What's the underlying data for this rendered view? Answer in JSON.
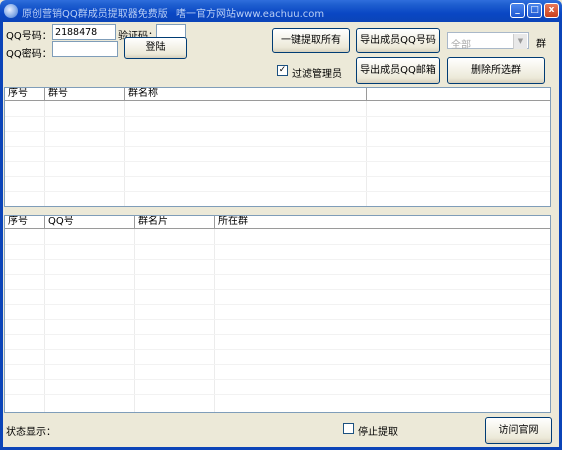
{
  "window": {
    "title": "原创营销QQ群成员提取器免费版",
    "site_text": "嗜一官方网站www.eachuu.com",
    "controls": {
      "minimize": "_",
      "maximize": "□",
      "close": "x"
    }
  },
  "login": {
    "qq_label": "QQ号码：",
    "qq_value": "2188478",
    "captcha_label": "验证码：",
    "captcha_value": "",
    "password_label": "QQ密码：",
    "password_value": "",
    "login_button": "登陆"
  },
  "actions": {
    "extract_all": "一键提取所有",
    "export_qq": "导出成员QQ号码",
    "filter_admin_label": "过滤管理员",
    "filter_admin_checked": "✓",
    "export_email": "导出成员QQ邮箱",
    "delete_selected": "删除所选群",
    "group_select_value": "全部",
    "group_label": "群"
  },
  "groups_table": {
    "columns": [
      "序号",
      "群号",
      "群名称"
    ]
  },
  "members_table": {
    "columns": [
      "序号",
      "QQ号",
      "群名片",
      "所在群"
    ]
  },
  "footer": {
    "status_label": "状态显示：",
    "stop_label": "停止提取",
    "visit_button": "访问官网"
  },
  "colors": {
    "titlebar": "#0a47c4",
    "window_bg": "#ece9d8",
    "border": "#7f9db9"
  }
}
